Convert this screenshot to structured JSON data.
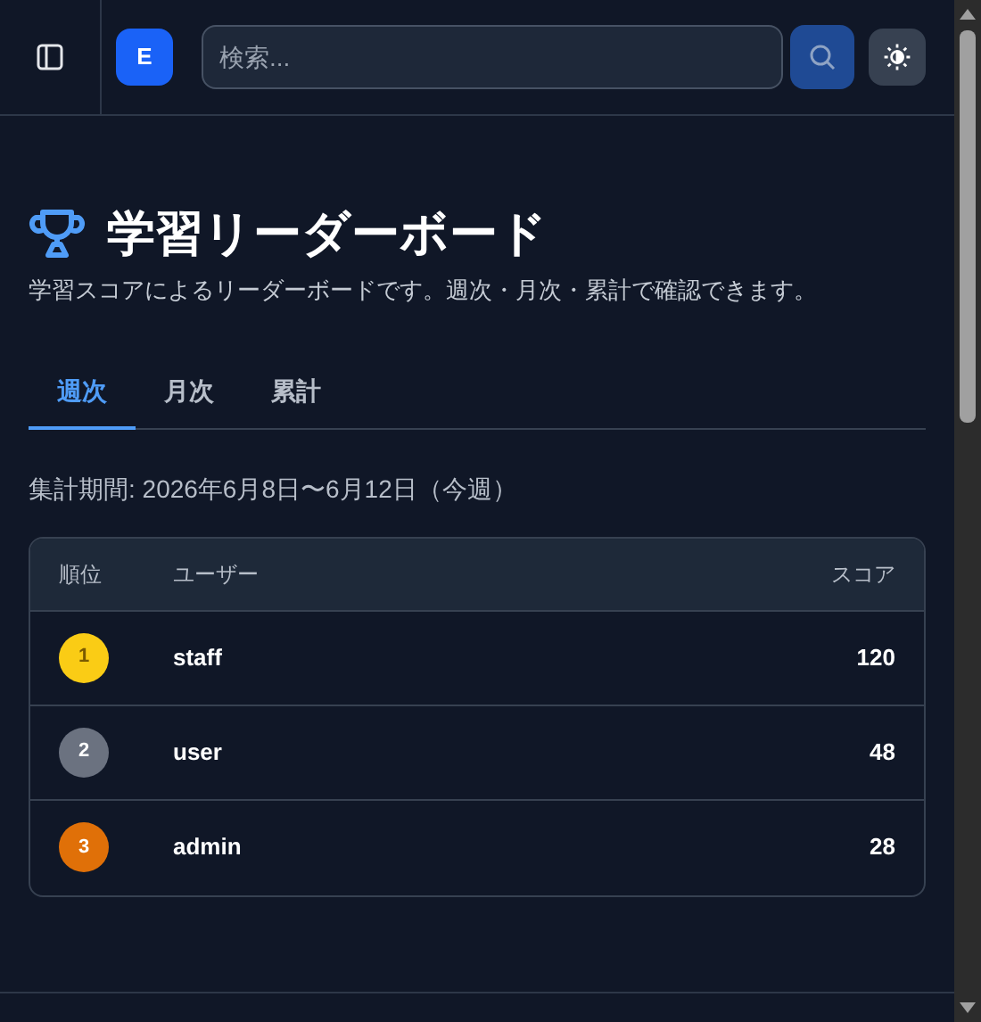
{
  "header": {
    "logo": "E",
    "search": {
      "placeholder": "検索..."
    }
  },
  "page": {
    "title": "学習リーダーボード",
    "subtitle": "学習スコアによるリーダーボードです。週次・月次・累計で確認できます。"
  },
  "tabs": [
    {
      "label": "週次",
      "selected": true
    },
    {
      "label": "月次",
      "selected": false
    },
    {
      "label": "累計",
      "selected": false
    }
  ],
  "period": "集計期間: 2026年6月8日〜6月12日（今週）",
  "table": {
    "columns": [
      "順位",
      "ユーザー",
      "スコア"
    ],
    "rows": [
      {
        "rank": "1",
        "color": "#facc15",
        "user": "staff",
        "score": "120"
      },
      {
        "rank": "2",
        "color": "#6b7280",
        "user": "user",
        "score": "48"
      },
      {
        "rank": "3",
        "color": "#e07008",
        "user": "admin",
        "score": "28"
      }
    ]
  }
}
